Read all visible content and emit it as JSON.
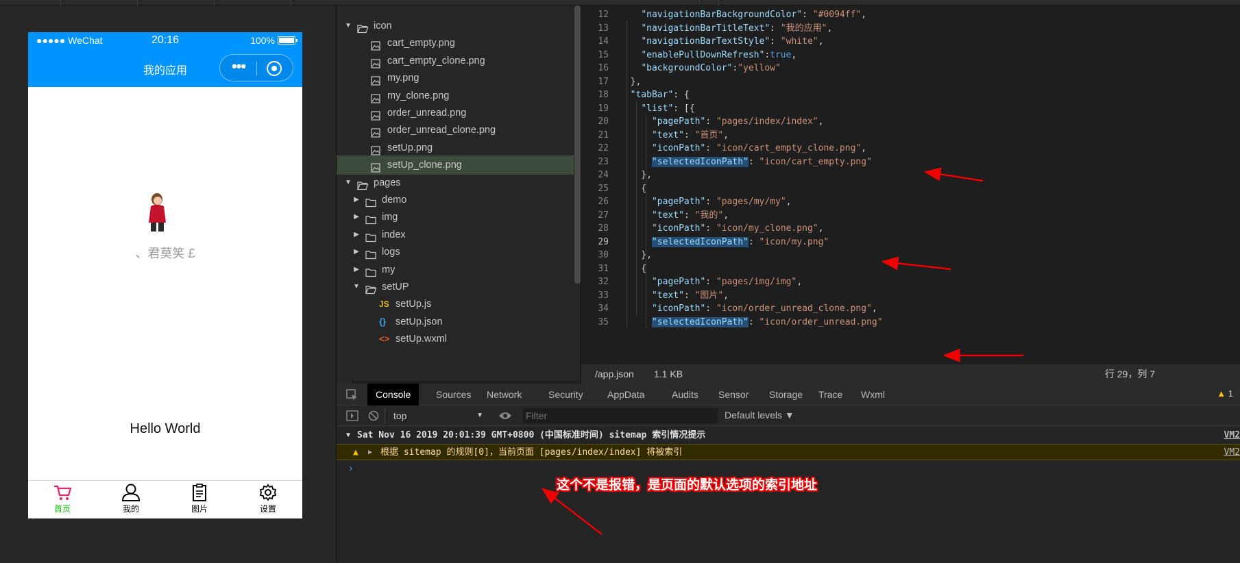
{
  "phone": {
    "carrier": "●●●●● WeChat",
    "time": "20:16",
    "battery": "100%",
    "nav_title": "我的应用",
    "nickname": "、君莫笑 £",
    "hello": "Hello World",
    "tabs": [
      {
        "label": "首页",
        "color": "#09bb07",
        "icon": "cart-icon"
      },
      {
        "label": "我的",
        "color": "#000000",
        "icon": "user-icon"
      },
      {
        "label": "图片",
        "color": "#000000",
        "icon": "clipboard-icon"
      },
      {
        "label": "设置",
        "color": "#000000",
        "icon": "gear-icon"
      }
    ],
    "accent": "#0094ff"
  },
  "tree": {
    "items": [
      {
        "label": "icon",
        "type": "folder-open",
        "expanded": true
      },
      {
        "label": "cart_empty.png",
        "type": "image"
      },
      {
        "label": "cart_empty_clone.png",
        "type": "image"
      },
      {
        "label": "my.png",
        "type": "image"
      },
      {
        "label": "my_clone.png",
        "type": "image"
      },
      {
        "label": "order_unread.png",
        "type": "image"
      },
      {
        "label": "order_unread_clone.png",
        "type": "image"
      },
      {
        "label": "setUp.png",
        "type": "image"
      },
      {
        "label": "setUp_clone.png",
        "type": "image",
        "selected": true
      },
      {
        "label": "pages",
        "type": "folder-open",
        "expanded": true
      },
      {
        "label": "demo",
        "type": "folder",
        "expanded": false
      },
      {
        "label": "img",
        "type": "folder",
        "expanded": false
      },
      {
        "label": "index",
        "type": "folder",
        "expanded": false
      },
      {
        "label": "logs",
        "type": "folder",
        "expanded": false
      },
      {
        "label": "my",
        "type": "folder",
        "expanded": false
      },
      {
        "label": "setUP",
        "type": "folder-open",
        "expanded": true
      },
      {
        "label": "setUp.js",
        "type": "js"
      },
      {
        "label": "setUp.json",
        "type": "json"
      },
      {
        "label": "setUp.wxml",
        "type": "wxml"
      }
    ]
  },
  "editor": {
    "first_line": 12,
    "active_line": 29,
    "lines": [
      "    \"navigationBarBackgroundColor\": \"#0094ff\",",
      "    \"navigationBarTitleText\": \"我的应用\",",
      "    \"navigationBarTextStyle\": \"white\",",
      "    \"enablePullDownRefresh\":true,",
      "    \"backgroundColor\":\"yellow\"",
      "  },",
      "  \"tabBar\": {",
      "    \"list\": [{",
      "      \"pagePath\": \"pages/index/index\",",
      "      \"text\": \"首页\",",
      "      \"iconPath\": \"icon/cart_empty_clone.png\",",
      "      \"selectedIconPath\": \"icon/cart_empty.png\"",
      "    },",
      "    {",
      "      \"pagePath\": \"pages/my/my\",",
      "      \"text\": \"我的\",",
      "      \"iconPath\": \"icon/my_clone.png\",",
      "      \"selectedIconPath\": \"icon/my.png\"",
      "    },",
      "    {",
      "      \"pagePath\": \"pages/img/img\",",
      "      \"text\": \"图片\",",
      "      \"iconPath\": \"icon/order_unread_clone.png\",",
      "      \"selectedIconPath\": \"icon/order_unread.png\""
    ],
    "file": "/app.json",
    "size": "1.1 KB",
    "position": "行 29，列 7"
  },
  "devtools": {
    "tabs": [
      "Console",
      "Sources",
      "Network",
      "Security",
      "AppData",
      "Audits",
      "Sensor",
      "Storage",
      "Trace",
      "Wxml"
    ],
    "active_tab": "Console",
    "warning_count": "1",
    "context": "top",
    "filter_placeholder": "Filter",
    "levels": "Default levels ▼",
    "group_header": "Sat Nov 16 2019 20:01:39 GMT+0800 (中国标准时间) sitemap 索引情况提示",
    "warning": "根据 sitemap 的规则[0]，当前页面 [pages/index/index] 将被索引",
    "source": "VM2",
    "prompt": "›"
  },
  "annotation": "这个不是报错，是页面的默认选项的索引地址"
}
